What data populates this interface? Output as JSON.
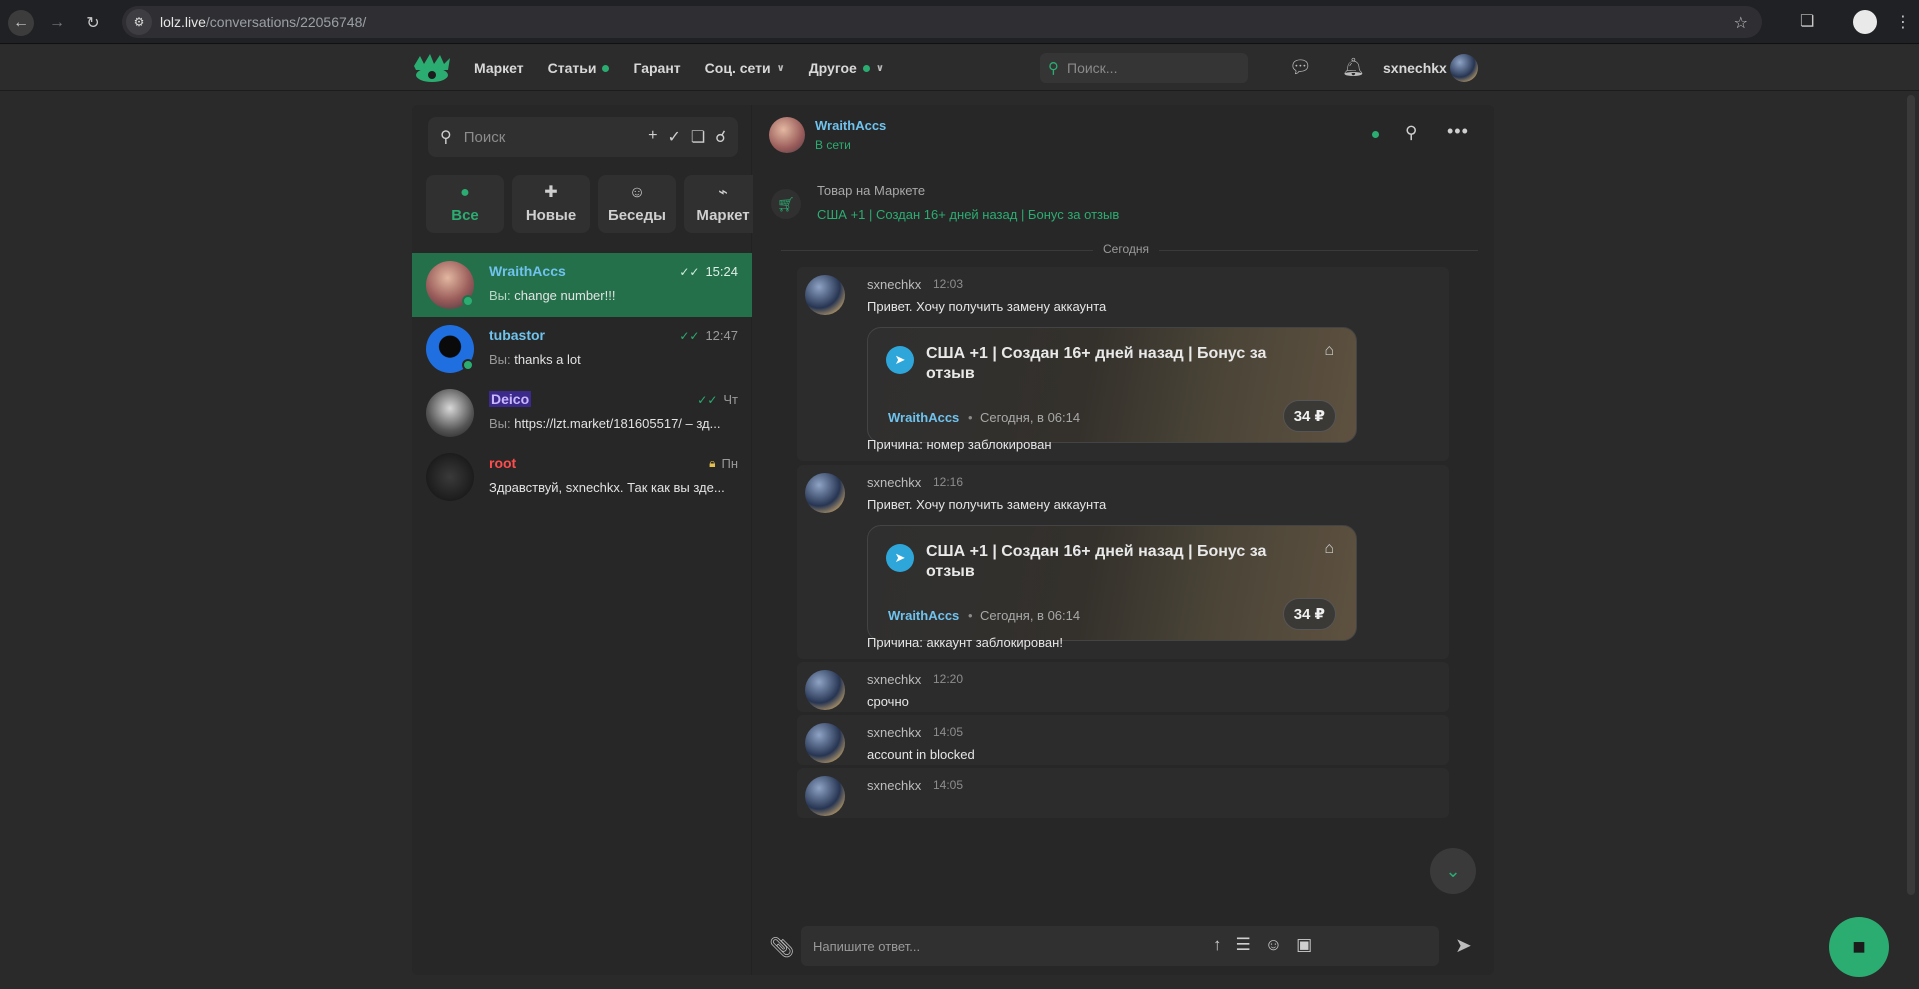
{
  "browser": {
    "url_host": "lolz.live",
    "url_path": "/conversations/22056748/"
  },
  "header": {
    "menu": [
      {
        "label": "Маркет",
        "dot": false,
        "chevron": false
      },
      {
        "label": "Статьи",
        "dot": true,
        "chevron": false
      },
      {
        "label": "Гарант",
        "dot": false,
        "chevron": false
      },
      {
        "label": "Соц. сети",
        "dot": false,
        "chevron": true
      },
      {
        "label": "Другое",
        "dot": true,
        "chevron": true
      }
    ],
    "search_placeholder": "Поиск...",
    "username": "sxnechkx"
  },
  "sidebar": {
    "search_placeholder": "Поиск",
    "filters": [
      {
        "label": "Все",
        "icon": "chats-icon",
        "active": true
      },
      {
        "label": "Новые",
        "icon": "new-message-icon",
        "active": false
      },
      {
        "label": "Беседы",
        "icon": "group-icon",
        "active": false
      },
      {
        "label": "Маркет",
        "icon": "cart-icon",
        "active": false
      }
    ],
    "conversations": [
      {
        "name": "WraithAccs",
        "name_color": "#6fc3ee",
        "time": "15:24",
        "you_prefix": "Вы:",
        "preview": "change number!!!",
        "status": "read",
        "online": true,
        "active": true
      },
      {
        "name": "tubastor",
        "name_color": "#6fc3ee",
        "time": "12:47",
        "you_prefix": "Вы:",
        "preview": "thanks a lot",
        "status": "read",
        "online": true,
        "active": false
      },
      {
        "name": "Deico",
        "name_color": "#c9b8ff",
        "time": "Чт",
        "you_prefix": "Вы:",
        "preview": "https://lzt.market/181605517/ – зд...",
        "status": "read",
        "online": false,
        "active": false
      },
      {
        "name": "root",
        "name_color": "#ff4d4d",
        "time": "Пн",
        "you_prefix": "",
        "preview": "Здравствуй, sxnechkx. Так как вы зде...",
        "status": "locked",
        "online": false,
        "active": false
      }
    ]
  },
  "chat": {
    "name": "WraithAccs",
    "status": "В сети",
    "market_item_title": "Товар на Маркете",
    "market_item_link": "США +1 | Создан 16+ дней назад | Бонус за отзыв",
    "day_separator": "Сегодня",
    "messages": [
      {
        "author": "sxnechkx",
        "time": "12:03",
        "text": "Привет. Хочу получить замену аккаунта",
        "card_title": "США +1 | Создан 16+ дней назад | Бонус за отзыв",
        "card_seller": "WraithAccs",
        "card_date": "Сегодня, в 06:14",
        "card_price": "34 ₽",
        "reason": "Причина: номер заблокирован"
      },
      {
        "author": "sxnechkx",
        "time": "12:16",
        "text": "Привет. Хочу получить замену аккаунта",
        "card_title": "США +1 | Создан 16+ дней назад | Бонус за отзыв",
        "card_seller": "WraithAccs",
        "card_date": "Сегодня, в 06:14",
        "card_price": "34 ₽",
        "reason": "Причина: аккаунт заблокирован!"
      },
      {
        "author": "sxnechkx",
        "time": "12:20",
        "text": "срочно"
      },
      {
        "author": "sxnechkx",
        "time": "14:05",
        "text": "account in blocked"
      },
      {
        "author": "sxnechkx",
        "time": "14:05",
        "text": ""
      }
    ],
    "reply_placeholder": "Напишите ответ...",
    "accent": "#2bad72"
  }
}
